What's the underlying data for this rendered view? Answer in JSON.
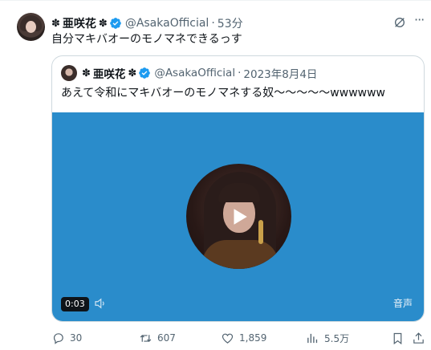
{
  "tweet": {
    "symbol_left": "✽",
    "display_name": "亜咲花",
    "symbol_right": "✽",
    "handle": "@AsakaOfficial",
    "separator": "·",
    "time": "53分",
    "text": "自分マキバオーのモノマネできるっす"
  },
  "quoted": {
    "symbol_left": "✽",
    "display_name": "亜咲花",
    "symbol_right": "✽",
    "handle": "@AsakaOfficial",
    "separator": "·",
    "date": "2023年8月4日",
    "text": "あえて令和にマキバオーのモノマネする奴〜〜〜〜〜wwwwww",
    "video": {
      "duration": "0:03",
      "audio_label": "音声",
      "background_color": "#2a8ccb"
    }
  },
  "actions": {
    "replies": "30",
    "reposts": "607",
    "likes": "1,859",
    "views": "5.5万"
  },
  "colors": {
    "text": "#0f1419",
    "muted": "#536471",
    "verified": "#1d9bf0",
    "border": "#cfd9de"
  }
}
